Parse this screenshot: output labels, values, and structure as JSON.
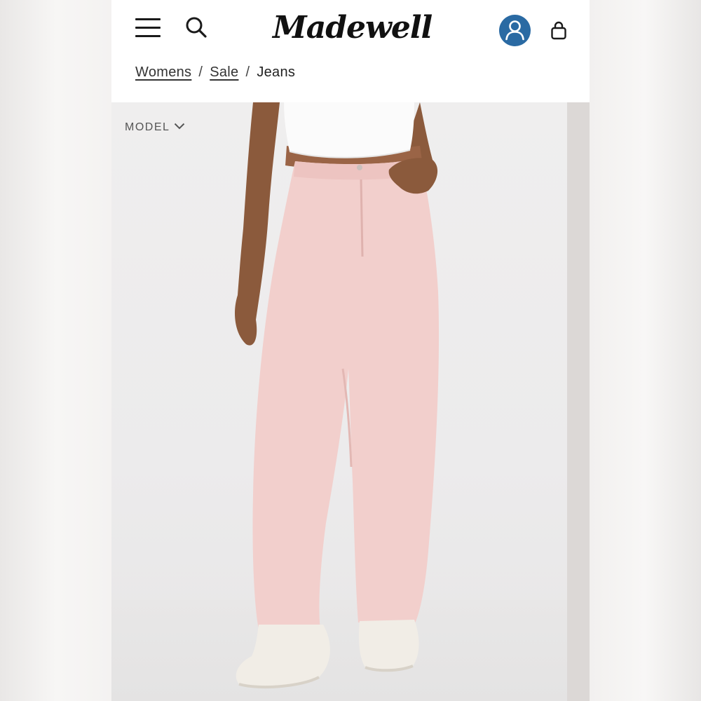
{
  "header": {
    "brand": "Madewell",
    "menu_icon": "hamburger-menu-icon",
    "search_icon": "search-icon",
    "account_icon": "user-account-icon",
    "bag_icon": "shopping-bag-icon",
    "account_color": "#2a6aa3"
  },
  "breadcrumb": {
    "items": [
      {
        "label": "Womens",
        "link": true
      },
      {
        "label": "Sale",
        "link": true
      },
      {
        "label": "Jeans",
        "link": false
      }
    ],
    "separator": "/"
  },
  "hero": {
    "model_toggle_label": "MODEL",
    "product_color": "#f2cfcc"
  }
}
